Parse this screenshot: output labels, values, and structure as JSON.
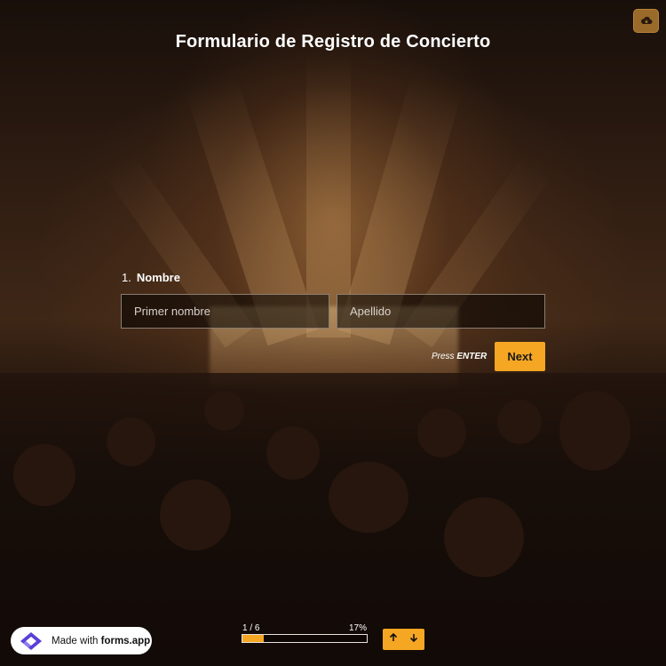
{
  "page": {
    "title": "Formulario de Registro de Concierto"
  },
  "header": {
    "cloud_icon": "cloud-save-icon"
  },
  "question": {
    "number": "1.",
    "label": "Nombre",
    "fields": [
      {
        "placeholder": "Primer nombre",
        "value": ""
      },
      {
        "placeholder": "Apellido",
        "value": ""
      }
    ]
  },
  "actions": {
    "press_prefix": "Press ",
    "press_key": "ENTER",
    "next_label": "Next"
  },
  "footer": {
    "badge_prefix": "Made with ",
    "badge_brand": "forms.app",
    "progress_count": "1 / 6",
    "progress_percent": "17%",
    "progress_value": 0.17,
    "nav_up_icon": "arrow-up-icon",
    "nav_down_icon": "arrow-down-icon"
  },
  "colors": {
    "accent": "#f5a623",
    "text": "#ffffff"
  }
}
